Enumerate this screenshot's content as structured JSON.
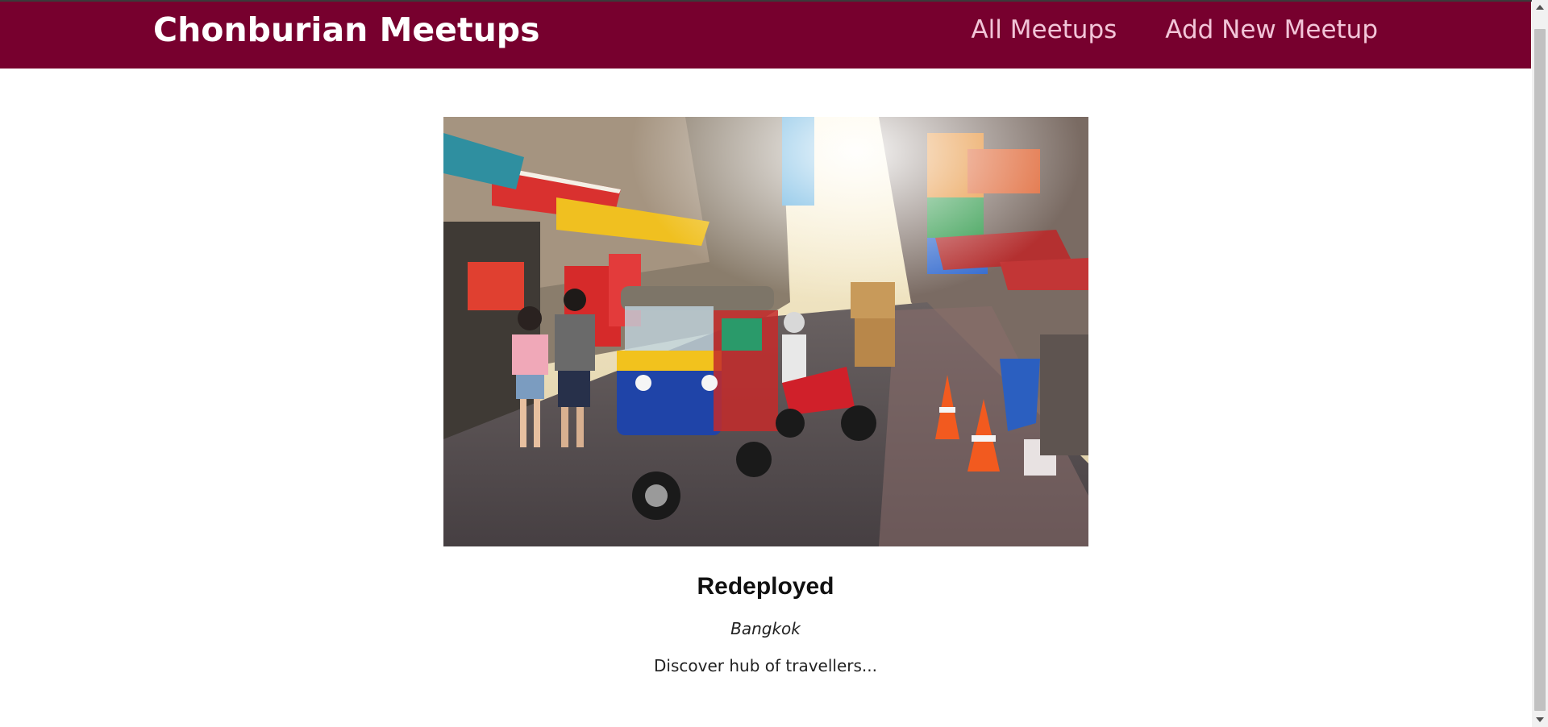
{
  "navbar": {
    "logo": "Chonburian Meetups",
    "links": [
      "All Meetups",
      "Add New Meetup"
    ],
    "background_color": "#77002e",
    "link_color": "#f2c5d8"
  },
  "meetup": {
    "title": "Redeployed",
    "address": "Bangkok",
    "description": "Discover hub of travellers...",
    "image_alt": "Bangkok street with tuk-tuk"
  }
}
